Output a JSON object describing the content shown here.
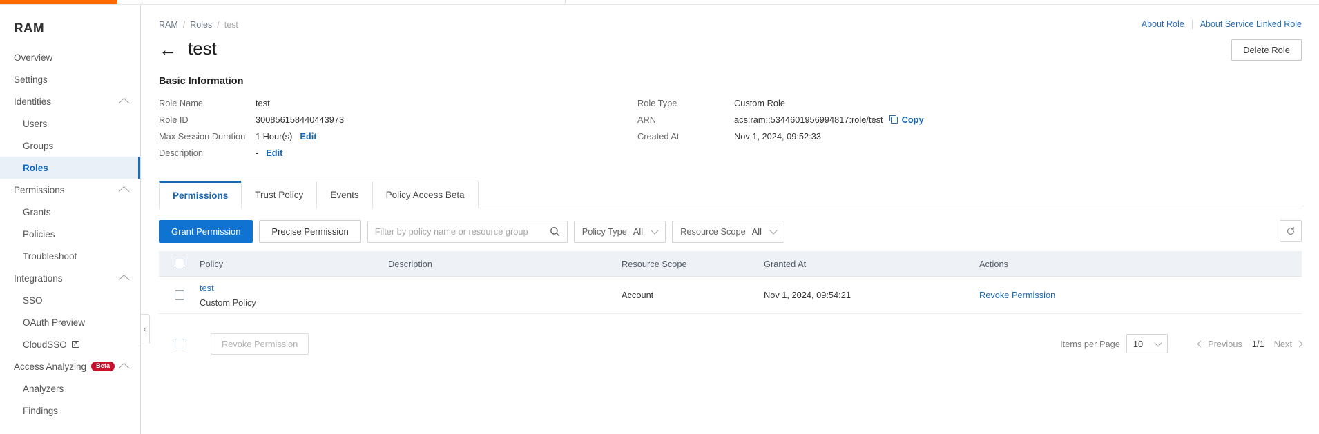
{
  "theme": {
    "accent_orange": "#ff6a00",
    "primary_blue": "#1072d1",
    "link_blue": "#1966b3",
    "beta_red": "#c8102e",
    "header_bg": "#eef1f5"
  },
  "sidebar": {
    "title": "RAM",
    "items": [
      {
        "label": "Overview",
        "type": "item",
        "icon": "",
        "active": false
      },
      {
        "label": "Settings",
        "type": "item",
        "icon": "",
        "active": false
      },
      {
        "label": "Identities",
        "type": "group",
        "icon": "chevron-up-icon",
        "active": false
      },
      {
        "label": "Users",
        "type": "sub",
        "icon": "",
        "active": false
      },
      {
        "label": "Groups",
        "type": "sub",
        "icon": "",
        "active": false
      },
      {
        "label": "Roles",
        "type": "sub",
        "icon": "",
        "active": true
      },
      {
        "label": "Permissions",
        "type": "group",
        "icon": "chevron-up-icon",
        "active": false
      },
      {
        "label": "Grants",
        "type": "sub",
        "icon": "",
        "active": false
      },
      {
        "label": "Policies",
        "type": "sub",
        "icon": "",
        "active": false
      },
      {
        "label": "Troubleshoot",
        "type": "sub",
        "icon": "",
        "active": false
      },
      {
        "label": "Integrations",
        "type": "group",
        "icon": "chevron-up-icon",
        "active": false
      },
      {
        "label": "SSO",
        "type": "sub",
        "icon": "",
        "active": false
      },
      {
        "label": "OAuth Preview",
        "type": "sub",
        "icon": "",
        "active": false
      },
      {
        "label": "CloudSSO",
        "type": "sub",
        "icon": "external-link-icon",
        "active": false
      },
      {
        "label": "Access Analyzing",
        "type": "group",
        "icon": "chevron-up-icon",
        "badge": "Beta",
        "active": false
      },
      {
        "label": "Analyzers",
        "type": "sub",
        "icon": "",
        "active": false
      },
      {
        "label": "Findings",
        "type": "sub",
        "icon": "",
        "active": false
      }
    ]
  },
  "breadcrumb": {
    "root": "RAM",
    "sep": "/",
    "section": "Roles",
    "current": "test"
  },
  "header": {
    "about_role": "About Role",
    "about_service_linked_role": "About Service Linked Role",
    "back_arrow": "←",
    "title": "test",
    "delete_role_label": "Delete Role"
  },
  "basic_information": {
    "section_title": "Basic Information",
    "left": [
      {
        "key": "Role Name",
        "value": "test",
        "action": ""
      },
      {
        "key": "Role ID",
        "value": "300856158440443973",
        "action": ""
      },
      {
        "key": "Max Session Duration",
        "value": "1 Hour(s)",
        "action": "Edit"
      },
      {
        "key": "Description",
        "value": "-",
        "action": "Edit"
      }
    ],
    "right": [
      {
        "key": "Role Type",
        "value": "Custom Role",
        "action": ""
      },
      {
        "key": "ARN",
        "value": "acs:ram::5344601956994817:role/test",
        "action": "Copy"
      },
      {
        "key": "Created At",
        "value": "Nov 1, 2024, 09:52:33",
        "action": ""
      }
    ]
  },
  "tabs": [
    {
      "label": "Permissions",
      "active": true
    },
    {
      "label": "Trust Policy",
      "active": false
    },
    {
      "label": "Events",
      "active": false
    },
    {
      "label": "Policy Access Beta",
      "active": false
    }
  ],
  "toolbar": {
    "grant_permission_label": "Grant Permission",
    "precise_permission_label": "Precise Permission",
    "search_placeholder": "Filter by policy name or resource group",
    "search_value": "",
    "search_icon": "search-icon",
    "policy_type_label": "Policy Type",
    "policy_type_value": "All",
    "resource_scope_label": "Resource Scope",
    "resource_scope_value": "All",
    "refresh_icon": "refresh-icon"
  },
  "table": {
    "columns": [
      "Policy",
      "Description",
      "Resource Scope",
      "Granted At",
      "Actions"
    ],
    "rows": [
      {
        "policy_name": "test",
        "policy_type": "Custom Policy",
        "description": "",
        "resource_scope": "Account",
        "granted_at": "Nov 1, 2024, 09:54:21",
        "action": "Revoke Permission"
      }
    ]
  },
  "footer": {
    "revoke_bulk_label": "Revoke Permission",
    "items_per_page_label": "Items per Page",
    "items_per_page_value": "10",
    "previous_label": "Previous",
    "page_indicator": "1/1",
    "next_label": "Next"
  }
}
